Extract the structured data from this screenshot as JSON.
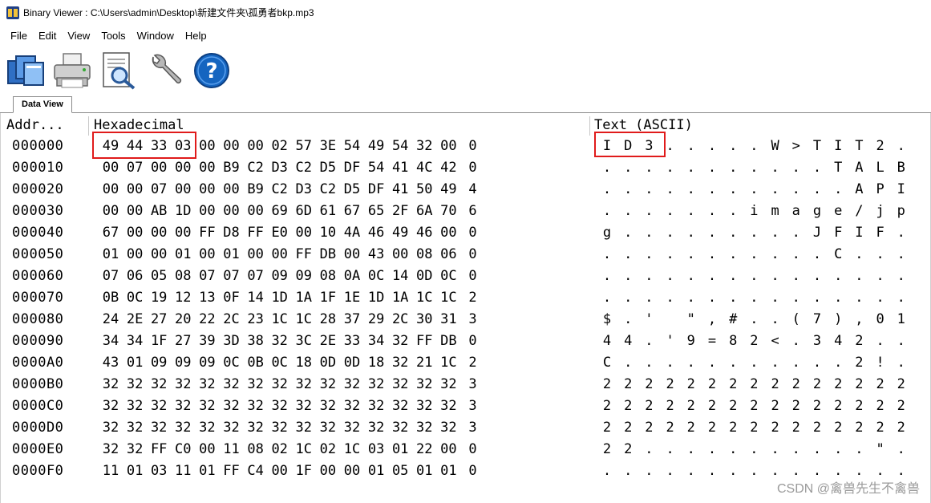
{
  "window": {
    "title": "Binary Viewer : C:\\Users\\admin\\Desktop\\新建文件夹\\孤勇者bkp.mp3"
  },
  "menu": [
    {
      "label": "File"
    },
    {
      "label": "Edit"
    },
    {
      "label": "View"
    },
    {
      "label": "Tools"
    },
    {
      "label": "Window"
    },
    {
      "label": "Help"
    }
  ],
  "toolbar": [
    {
      "icon": "open-files-icon"
    },
    {
      "icon": "printer-icon"
    },
    {
      "icon": "print-preview-icon"
    },
    {
      "icon": "wrench-icon"
    },
    {
      "icon": "help-icon"
    }
  ],
  "tabs": [
    {
      "label": "Data View"
    }
  ],
  "view": {
    "addr_header": "Addr...",
    "hex_header": "Hexadecimal",
    "text_header": "Text (ASCII)",
    "rows": [
      {
        "addr": "000000",
        "hex": [
          "49",
          "44",
          "33",
          "03",
          "00",
          "00",
          "00",
          "02",
          "57",
          "3E",
          "54",
          "49",
          "54",
          "32",
          "00",
          "0"
        ],
        "text": [
          "I",
          "D",
          "3",
          ".",
          ".",
          ".",
          ".",
          ".",
          "W",
          ">",
          "T",
          "I",
          "T",
          "2",
          "."
        ]
      },
      {
        "addr": "000010",
        "hex": [
          "00",
          "07",
          "00",
          "00",
          "00",
          "B9",
          "C2",
          "D3",
          "C2",
          "D5",
          "DF",
          "54",
          "41",
          "4C",
          "42",
          "0"
        ],
        "text": [
          ".",
          ".",
          ".",
          ".",
          ".",
          ".",
          ".",
          ".",
          ".",
          ".",
          ".",
          "T",
          "A",
          "L",
          "B"
        ]
      },
      {
        "addr": "000020",
        "hex": [
          "00",
          "00",
          "07",
          "00",
          "00",
          "00",
          "B9",
          "C2",
          "D3",
          "C2",
          "D5",
          "DF",
          "41",
          "50",
          "49",
          "4"
        ],
        "text": [
          ".",
          ".",
          ".",
          ".",
          ".",
          ".",
          ".",
          ".",
          ".",
          ".",
          ".",
          ".",
          "A",
          "P",
          "I"
        ]
      },
      {
        "addr": "000030",
        "hex": [
          "00",
          "00",
          "AB",
          "1D",
          "00",
          "00",
          "00",
          "69",
          "6D",
          "61",
          "67",
          "65",
          "2F",
          "6A",
          "70",
          "6"
        ],
        "text": [
          ".",
          ".",
          ".",
          ".",
          ".",
          ".",
          ".",
          "i",
          "m",
          "a",
          "g",
          "e",
          "/",
          "j",
          "p"
        ]
      },
      {
        "addr": "000040",
        "hex": [
          "67",
          "00",
          "00",
          "00",
          "FF",
          "D8",
          "FF",
          "E0",
          "00",
          "10",
          "4A",
          "46",
          "49",
          "46",
          "00",
          "0"
        ],
        "text": [
          "g",
          ".",
          ".",
          ".",
          ".",
          ".",
          ".",
          ".",
          ".",
          ".",
          "J",
          "F",
          "I",
          "F",
          "."
        ]
      },
      {
        "addr": "000050",
        "hex": [
          "01",
          "00",
          "00",
          "01",
          "00",
          "01",
          "00",
          "00",
          "FF",
          "DB",
          "00",
          "43",
          "00",
          "08",
          "06",
          "0"
        ],
        "text": [
          ".",
          ".",
          ".",
          ".",
          ".",
          ".",
          ".",
          ".",
          ".",
          ".",
          ".",
          "C",
          ".",
          ".",
          "."
        ]
      },
      {
        "addr": "000060",
        "hex": [
          "07",
          "06",
          "05",
          "08",
          "07",
          "07",
          "07",
          "09",
          "09",
          "08",
          "0A",
          "0C",
          "14",
          "0D",
          "0C",
          "0"
        ],
        "text": [
          ".",
          ".",
          ".",
          ".",
          ".",
          ".",
          ".",
          ".",
          ".",
          ".",
          ".",
          ".",
          ".",
          ".",
          "."
        ]
      },
      {
        "addr": "000070",
        "hex": [
          "0B",
          "0C",
          "19",
          "12",
          "13",
          "0F",
          "14",
          "1D",
          "1A",
          "1F",
          "1E",
          "1D",
          "1A",
          "1C",
          "1C",
          "2"
        ],
        "text": [
          ".",
          ".",
          ".",
          ".",
          ".",
          ".",
          ".",
          ".",
          ".",
          ".",
          ".",
          ".",
          ".",
          ".",
          "."
        ]
      },
      {
        "addr": "000080",
        "hex": [
          "24",
          "2E",
          "27",
          "20",
          "22",
          "2C",
          "23",
          "1C",
          "1C",
          "28",
          "37",
          "29",
          "2C",
          "30",
          "31",
          "3"
        ],
        "text": [
          "$",
          ".",
          "'",
          " ",
          "\"",
          ",",
          "#",
          ".",
          ".",
          "(",
          "7",
          ")",
          ",",
          "0",
          "1"
        ]
      },
      {
        "addr": "000090",
        "hex": [
          "34",
          "34",
          "1F",
          "27",
          "39",
          "3D",
          "38",
          "32",
          "3C",
          "2E",
          "33",
          "34",
          "32",
          "FF",
          "DB",
          "0"
        ],
        "text": [
          "4",
          "4",
          ".",
          "'",
          "9",
          "=",
          "8",
          "2",
          "<",
          ".",
          "3",
          "4",
          "2",
          ".",
          "."
        ]
      },
      {
        "addr": "0000A0",
        "hex": [
          "43",
          "01",
          "09",
          "09",
          "09",
          "0C",
          "0B",
          "0C",
          "18",
          "0D",
          "0D",
          "18",
          "32",
          "21",
          "1C",
          "2"
        ],
        "text": [
          "C",
          ".",
          ".",
          ".",
          ".",
          ".",
          ".",
          ".",
          ".",
          ".",
          ".",
          ".",
          "2",
          "!",
          "."
        ]
      },
      {
        "addr": "0000B0",
        "hex": [
          "32",
          "32",
          "32",
          "32",
          "32",
          "32",
          "32",
          "32",
          "32",
          "32",
          "32",
          "32",
          "32",
          "32",
          "32",
          "3"
        ],
        "text": [
          "2",
          "2",
          "2",
          "2",
          "2",
          "2",
          "2",
          "2",
          "2",
          "2",
          "2",
          "2",
          "2",
          "2",
          "2"
        ]
      },
      {
        "addr": "0000C0",
        "hex": [
          "32",
          "32",
          "32",
          "32",
          "32",
          "32",
          "32",
          "32",
          "32",
          "32",
          "32",
          "32",
          "32",
          "32",
          "32",
          "3"
        ],
        "text": [
          "2",
          "2",
          "2",
          "2",
          "2",
          "2",
          "2",
          "2",
          "2",
          "2",
          "2",
          "2",
          "2",
          "2",
          "2"
        ]
      },
      {
        "addr": "0000D0",
        "hex": [
          "32",
          "32",
          "32",
          "32",
          "32",
          "32",
          "32",
          "32",
          "32",
          "32",
          "32",
          "32",
          "32",
          "32",
          "32",
          "3"
        ],
        "text": [
          "2",
          "2",
          "2",
          "2",
          "2",
          "2",
          "2",
          "2",
          "2",
          "2",
          "2",
          "2",
          "2",
          "2",
          "2"
        ]
      },
      {
        "addr": "0000E0",
        "hex": [
          "32",
          "32",
          "FF",
          "C0",
          "00",
          "11",
          "08",
          "02",
          "1C",
          "02",
          "1C",
          "03",
          "01",
          "22",
          "00",
          "0"
        ],
        "text": [
          "2",
          "2",
          ".",
          ".",
          ".",
          ".",
          ".",
          ".",
          ".",
          ".",
          ".",
          ".",
          ".",
          "\"",
          "."
        ]
      },
      {
        "addr": "0000F0",
        "hex": [
          "11",
          "01",
          "03",
          "11",
          "01",
          "FF",
          "C4",
          "00",
          "1F",
          "00",
          "00",
          "01",
          "05",
          "01",
          "01",
          "0"
        ],
        "text": [
          ".",
          ".",
          ".",
          ".",
          ".",
          ".",
          ".",
          ".",
          ".",
          ".",
          ".",
          ".",
          ".",
          ".",
          "."
        ]
      }
    ]
  },
  "watermark": "CSDN @禽兽先生不禽兽",
  "colors": {
    "highlight": "#e01b1b",
    "help_blue": "#1565c0"
  }
}
